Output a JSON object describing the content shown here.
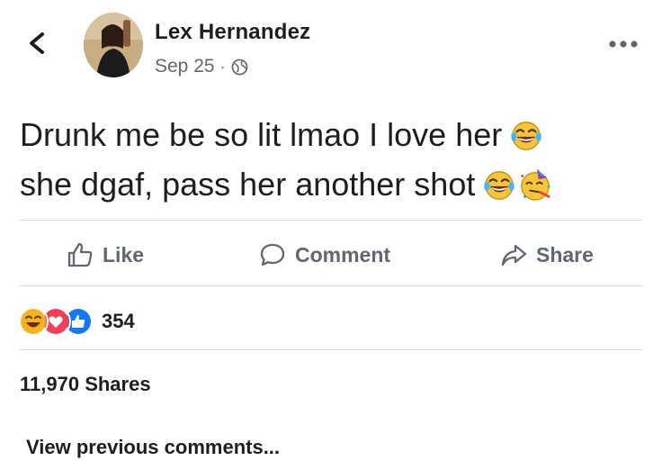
{
  "post": {
    "author": "Lex Hernandez",
    "date": "Sep 25",
    "separator": "·",
    "privacy_icon": "globe-icon",
    "text_line_1": "Drunk me be so lit lmao I love her",
    "text_line_2": "she dgaf, pass her another shot"
  },
  "actions": {
    "like_label": "Like",
    "comment_label": "Comment",
    "share_label": "Share"
  },
  "reactions": {
    "types": [
      "haha",
      "love",
      "like"
    ],
    "count": "354"
  },
  "shares_text": "11,970 Shares",
  "view_previous": "View previous comments...",
  "colors": {
    "text": "#1c1e21",
    "secondary": "#65676b",
    "action": "#606770",
    "like_blue": "#1877f2",
    "love_red": "#f33e58",
    "haha_yellow": "#f7b125"
  }
}
